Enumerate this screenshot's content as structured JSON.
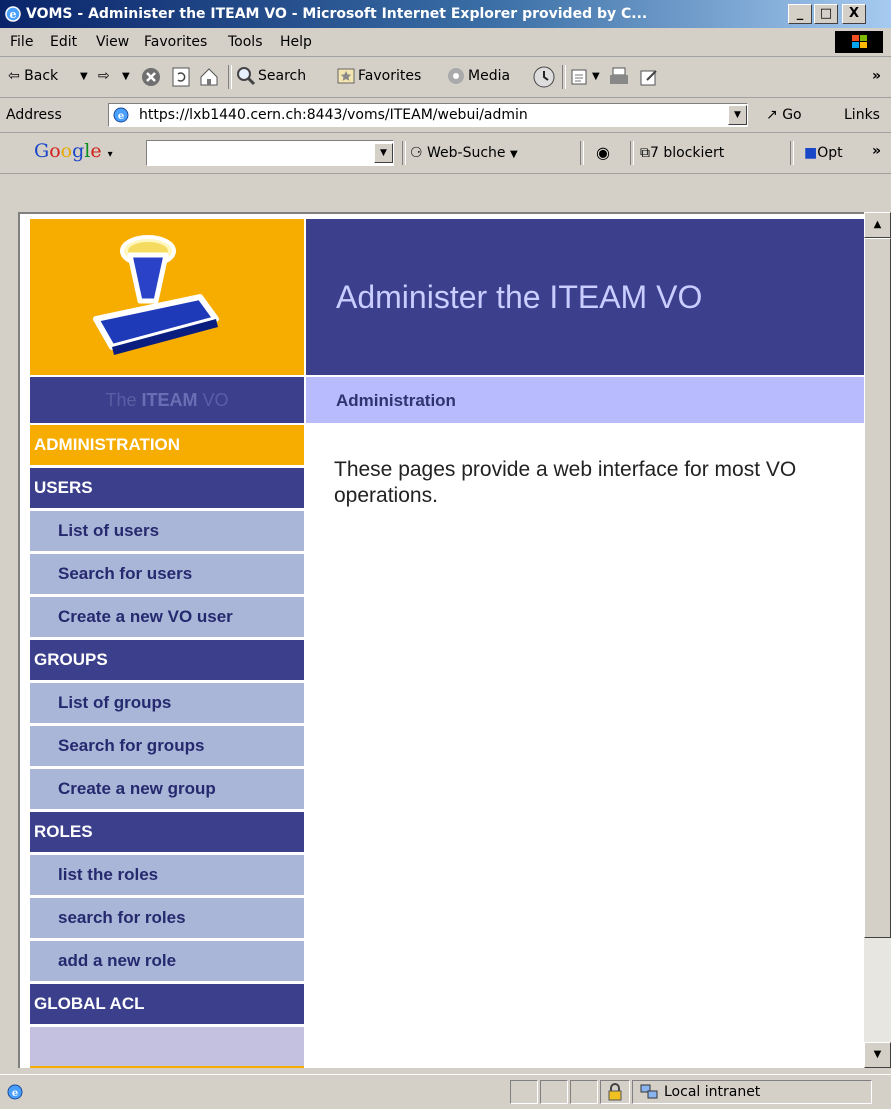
{
  "window": {
    "title": "VOMS - Administer the ITEAM VO - Microsoft Internet Explorer provided by C...",
    "minimize": "_",
    "maximize": "□",
    "close": "X"
  },
  "menu": [
    "File",
    "Edit",
    "View",
    "Favorites",
    "Tools",
    "Help"
  ],
  "toolbar": {
    "back": "⇦ Back",
    "forward": "⇨",
    "search": "Search",
    "favorites": "Favorites",
    "media": "Media",
    "more": "»"
  },
  "address": {
    "label": "Address",
    "url": "https://lxb1440.cern.ch:8443/voms/ITEAM/webui/admin",
    "go": "Go",
    "links": "Links"
  },
  "google": {
    "logo": "Google",
    "search_value": "",
    "websuche": "Web-Suche",
    "blocked": "7 blockiert",
    "options": "Opt",
    "more": "»"
  },
  "page": {
    "header_title": "Administer the ITEAM VO",
    "vo_label_prefix": "The",
    "vo_label_name": "ITEAM",
    "vo_label_suffix": "VO",
    "section_title": "Administration",
    "content": "These pages provide a web interface for most VO operations."
  },
  "nav": {
    "administration": "ADMINISTRATION",
    "users": "USERS",
    "list_users": "List of users",
    "search_users": "Search for users",
    "create_user": "Create a new VO user",
    "groups": "GROUPS",
    "list_groups": "List of groups",
    "search_groups": "Search for groups",
    "create_group": "Create a new group",
    "roles": "ROLES",
    "list_roles": "list the roles",
    "search_roles": "search for roles",
    "add_role": "add a new role",
    "global_acl": "GLOBAL ACL"
  },
  "status": {
    "zone": "Local intranet"
  },
  "colors": {
    "accent_orange": "#f7ad00",
    "header_blue": "#3c3f8c",
    "nav_item": "#a9b6d8",
    "subheader": "#b8bcff"
  },
  "icons": [
    "ie-logo-icon",
    "windows-flag-icon",
    "stop-icon",
    "refresh-icon",
    "home-icon",
    "search-icon",
    "favorites-icon",
    "media-icon",
    "history-icon",
    "mail-icon",
    "print-icon",
    "edit-icon",
    "globe-icon",
    "go-arrow-icon",
    "lock-icon",
    "intranet-icon",
    "stamp-logo"
  ]
}
